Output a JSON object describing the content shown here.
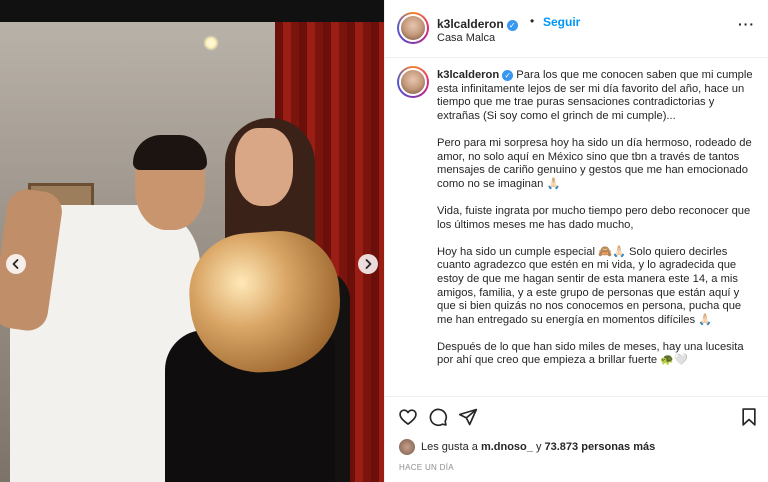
{
  "post": {
    "photo_alt": "",
    "header": {
      "username": "k3lcalderon",
      "follow_label": "Seguir",
      "separator": "•",
      "location": "Casa Malca",
      "more_label": "···"
    },
    "caption": {
      "username": "k3lcalderon",
      "paragraphs": [
        "Para los que me conocen saben que mi cumple esta infinitamente lejos de ser mi día favorito del año, hace un tiempo que me trae puras sensaciones contradictorias y extrañas (Si soy como el grinch de mi cumple)...",
        "Pero para mi sorpresa hoy ha sido un día hermoso, rodeado de amor, no solo aquí en México sino que tbn a través de tantos mensajes de cariño genuino y gestos que me han emocionado como no se imaginan 🙏🏻",
        "Vida, fuiste ingrata por mucho tiempo pero debo reconocer que los últimos meses me has dado mucho,",
        "Hoy ha sido un cumple especial 🙈🙏🏻 Solo quiero decirles cuanto agradezco que estén en mi vida, y lo agradecida que estoy de que me hagan sentir de esta manera este 14, a mis amigos, familia, y a este grupo de personas que están aquí y que si bien quizás no nos conocemos en persona, pucha que me han entregado su energía en momentos difíciles 🙏🏻",
        "Después de lo que han sido miles de meses, hay una lucesita por ahí que creo que empieza a brillar fuerte 🐢🤍"
      ]
    },
    "likes": {
      "prefix": "Les gusta a",
      "user": "m.dnoso_",
      "middle": "y",
      "count": "73.873",
      "suffix": "personas más"
    },
    "timestamp": "HACE UN DÍA"
  },
  "icons": {
    "like": "heart-icon",
    "comment": "comment-icon",
    "share": "share-icon",
    "save": "bookmark-icon",
    "verified": "verified-badge-icon",
    "prev": "chevron-left-icon",
    "next": "chevron-right-icon"
  },
  "colors": {
    "accent": "#0095f6",
    "verified": "#3897f0",
    "text": "#262626",
    "muted": "#8e8e8e"
  }
}
